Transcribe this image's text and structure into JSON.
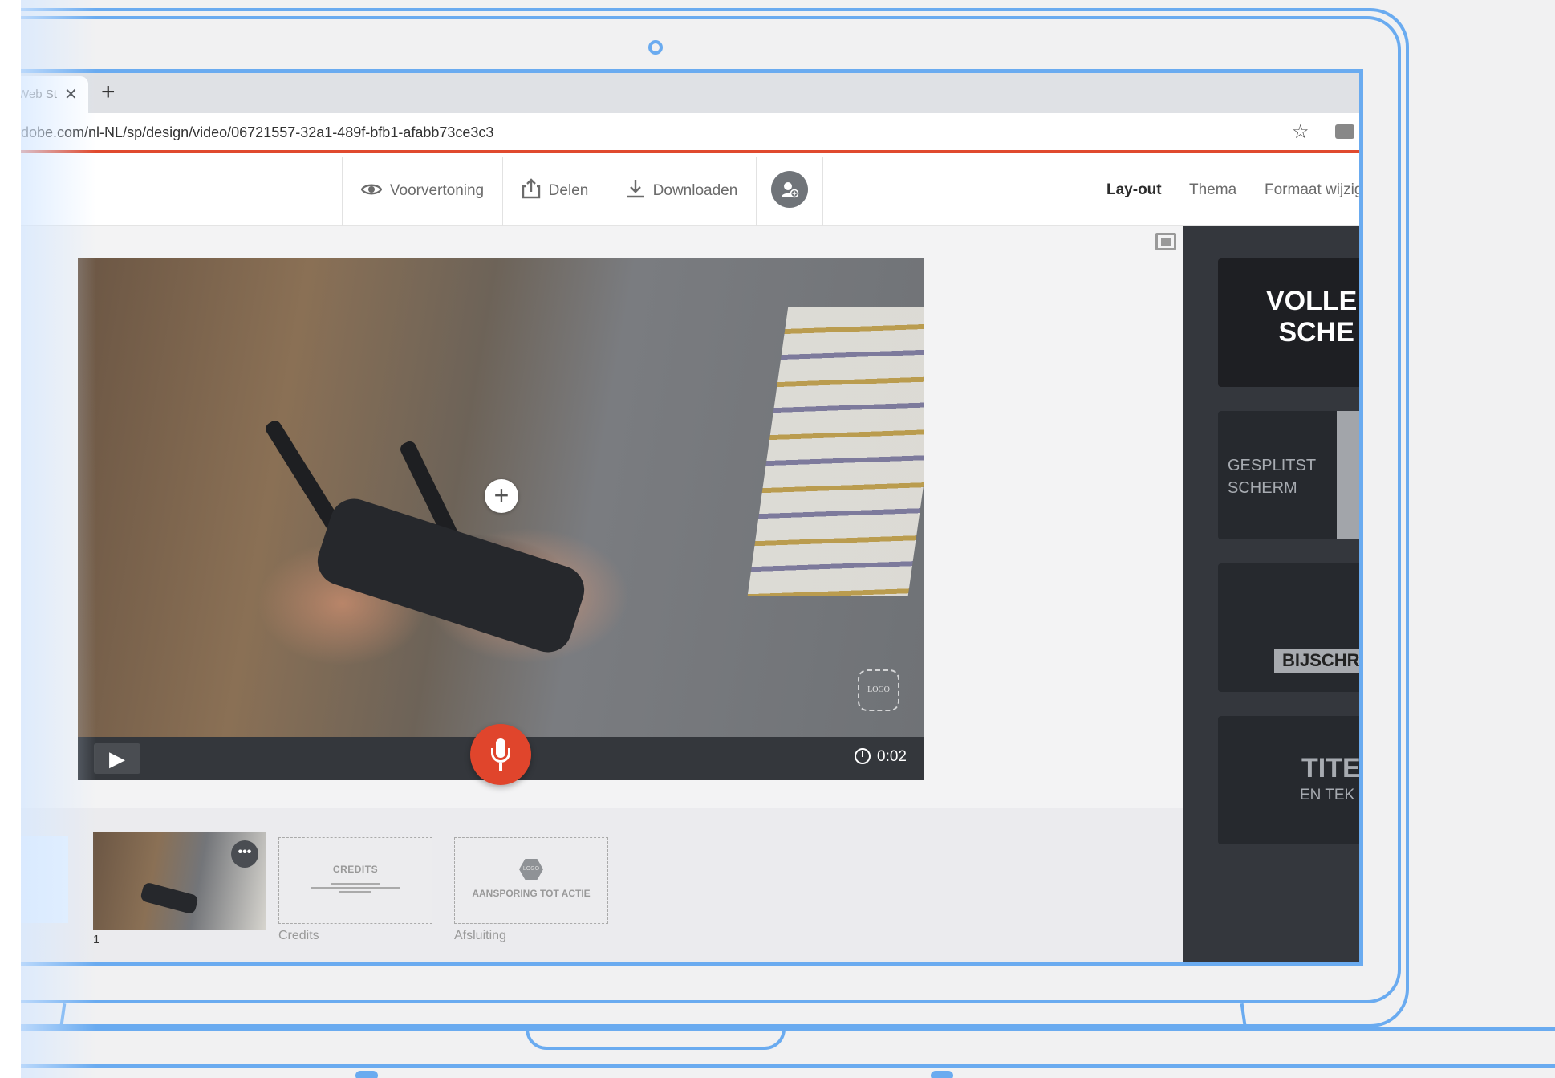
{
  "browser": {
    "tab_title": "Web St",
    "tab_close": "✕",
    "new_tab": "+",
    "url": "dobe.com/nl-NL/sp/design/video/06721557-32a1-489f-bfb1-afabb73ce3c3",
    "star": "☆"
  },
  "toolbar": {
    "preview_label": "Voorvertoning",
    "share_label": "Delen",
    "download_label": "Downloaden",
    "tabs": [
      "Lay-out",
      "Thema",
      "Formaat wijzig"
    ]
  },
  "player": {
    "time": "0:02",
    "play_icon": "▶",
    "add_icon": "+",
    "logo_text": "LOGO"
  },
  "timeline": {
    "scene_number": "1",
    "more_icon": "•••",
    "credits_title": "CREDITS",
    "credits_label": "Credits",
    "closing_logo": "LOGO",
    "closing_title": "AANSPORING TOT ACTIE",
    "closing_label": "Afsluiting"
  },
  "layouts": {
    "full_line1": "VOLLE",
    "full_line2": "SCHE",
    "split_line1": "GESPLITST",
    "split_line2": "SCHERM",
    "caption": "BIJSCHR",
    "title_line1": "TITE",
    "title_line2": "EN TEK"
  },
  "colors": {
    "frame": "#6aabf0",
    "accent_red": "#e0452c",
    "panel_dark": "#34373d"
  }
}
